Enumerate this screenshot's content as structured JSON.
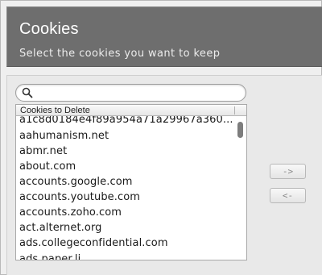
{
  "header": {
    "title": "Cookies",
    "subtitle": "Select the cookies you want to keep"
  },
  "search": {
    "value": "",
    "placeholder": ""
  },
  "list": {
    "column_header": "Cookies to Delete",
    "rows": [
      "a1c8d0184e4f89a954a71a29967a360...",
      "aahumanism.net",
      "abmr.net",
      "about.com",
      "accounts.google.com",
      "accounts.youtube.com",
      "accounts.zoho.com",
      "act.alternet.org",
      "ads.collegeconfidential.com",
      "ads.paper.li"
    ]
  },
  "buttons": {
    "keep_label": "->",
    "delete_label": "<-"
  },
  "icons": {
    "search": "search-icon"
  }
}
